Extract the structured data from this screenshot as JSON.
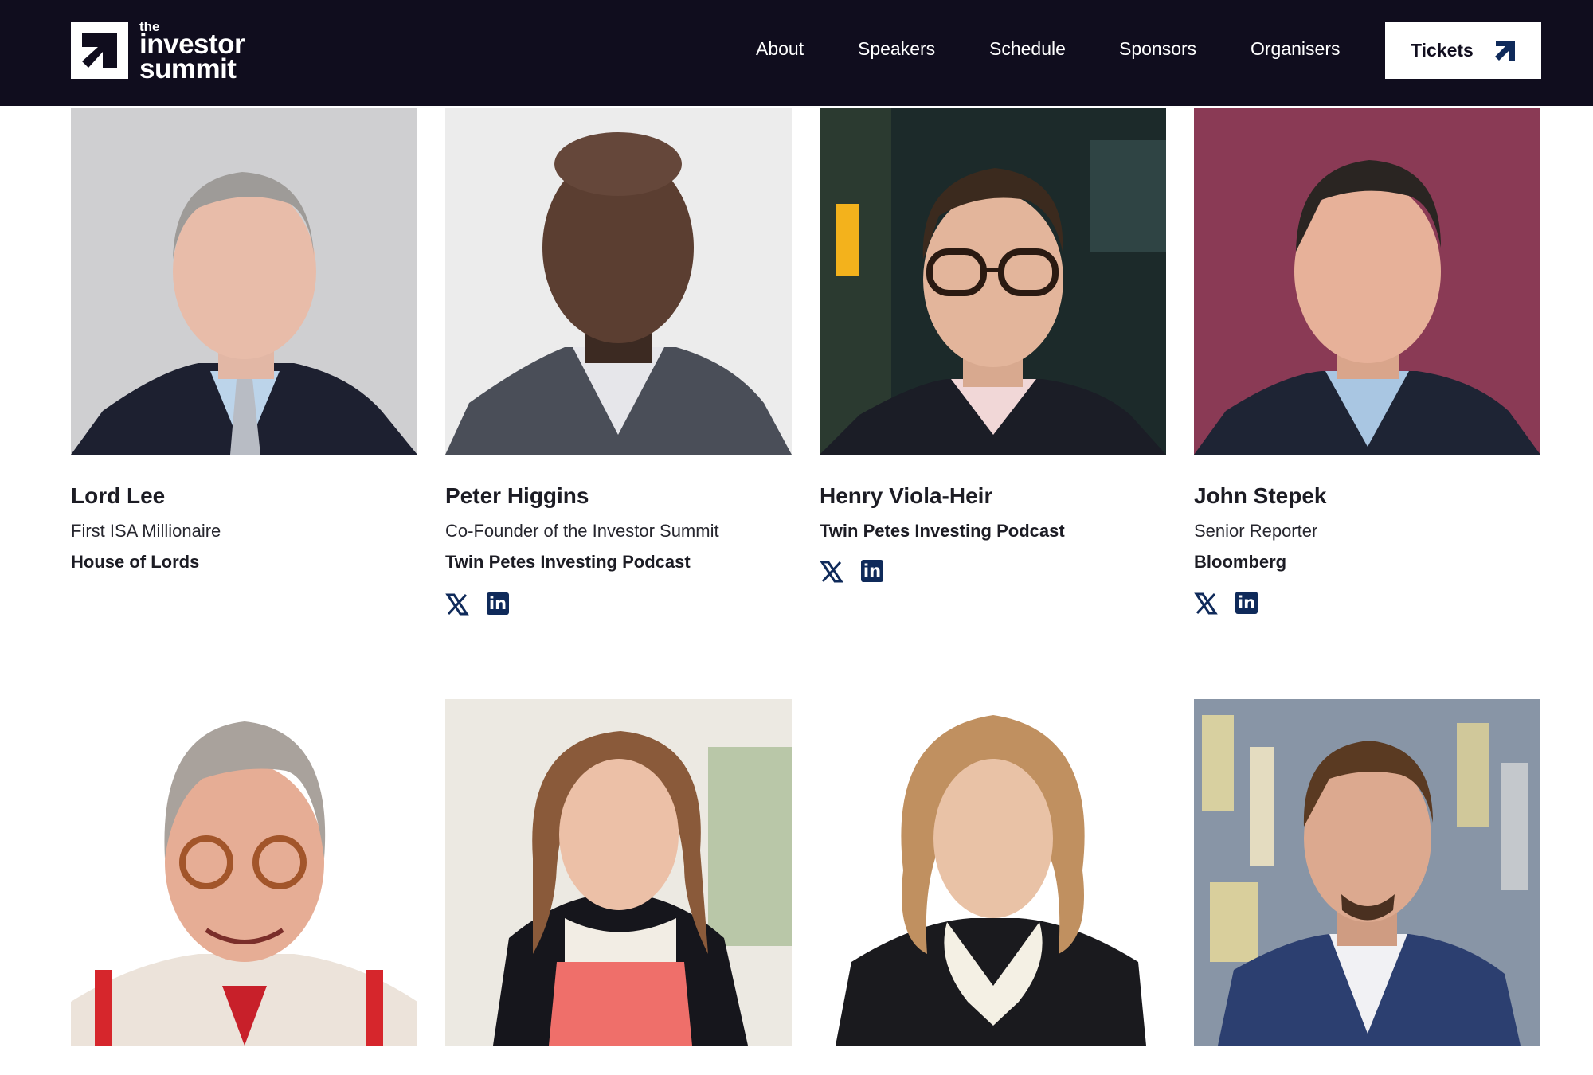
{
  "header": {
    "logo": {
      "the": "the",
      "line1": "investor",
      "line2": "summit"
    },
    "nav": [
      "About",
      "Speakers",
      "Schedule",
      "Sponsors",
      "Organisers"
    ],
    "tickets_label": "Tickets"
  },
  "speakers": [
    {
      "name": "Lord Lee",
      "role": "First ISA Millionaire",
      "org": "House of Lords",
      "socials": []
    },
    {
      "name": "Peter Higgins",
      "role": "Co-Founder of the Investor Summit",
      "org": "Twin Petes Investing Podcast",
      "socials": [
        "x-icon",
        "linkedin-icon"
      ]
    },
    {
      "name": "Henry Viola-Heir",
      "role": "",
      "org": "Twin Petes Investing Podcast",
      "socials": [
        "x-icon",
        "linkedin-icon"
      ]
    },
    {
      "name": "John Stepek",
      "role": "Senior Reporter",
      "org": "Bloomberg",
      "socials": [
        "x-icon",
        "linkedin-icon"
      ]
    }
  ],
  "second_row": [
    {
      "photo": "speaker-photo"
    },
    {
      "photo": "speaker-photo"
    },
    {
      "photo": "speaker-photo"
    },
    {
      "photo": "speaker-photo"
    }
  ],
  "colors": {
    "header_bg": "#100d1e",
    "social_icon": "#0f2a5a"
  }
}
